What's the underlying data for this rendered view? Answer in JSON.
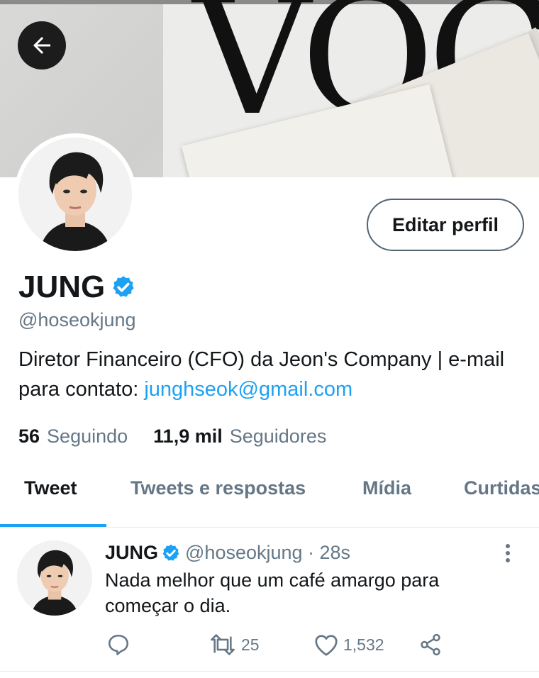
{
  "header": {
    "banner_text": "VOGU",
    "back_icon": "arrow-left-icon"
  },
  "profile": {
    "edit_button_label": "Editar perfil",
    "display_name": "JUNG",
    "verified_icon": "verified-badge-icon",
    "handle": "@hoseokjung",
    "bio_text": "Diretor Financeiro (CFO) da Jeon's Company | e-mail para contato: ",
    "bio_link": "junghseok@gmail.com",
    "following_count": "56",
    "following_label": "Seguindo",
    "followers_count": "11,9 mil",
    "followers_label": "Seguidores"
  },
  "tabs": [
    {
      "label": "Tweet",
      "active": true
    },
    {
      "label": "Tweets e respostas",
      "active": false
    },
    {
      "label": "Mídia",
      "active": false
    },
    {
      "label": "Curtidas",
      "active": false
    }
  ],
  "tweet": {
    "name": "JUNG",
    "handle_time": "@hoseokjung · 28s",
    "text": "Nada melhor que um café amargo para começar o dia.",
    "reply_icon": "reply-icon",
    "retweet_icon": "retweet-icon",
    "retweet_count": "25",
    "like_icon": "heart-icon",
    "like_count": "1,532",
    "share_icon": "share-icon",
    "more_icon": "more-vertical-icon"
  },
  "colors": {
    "accent": "#1da1f2",
    "secondary_text": "#657786",
    "primary_text": "#14171a"
  }
}
